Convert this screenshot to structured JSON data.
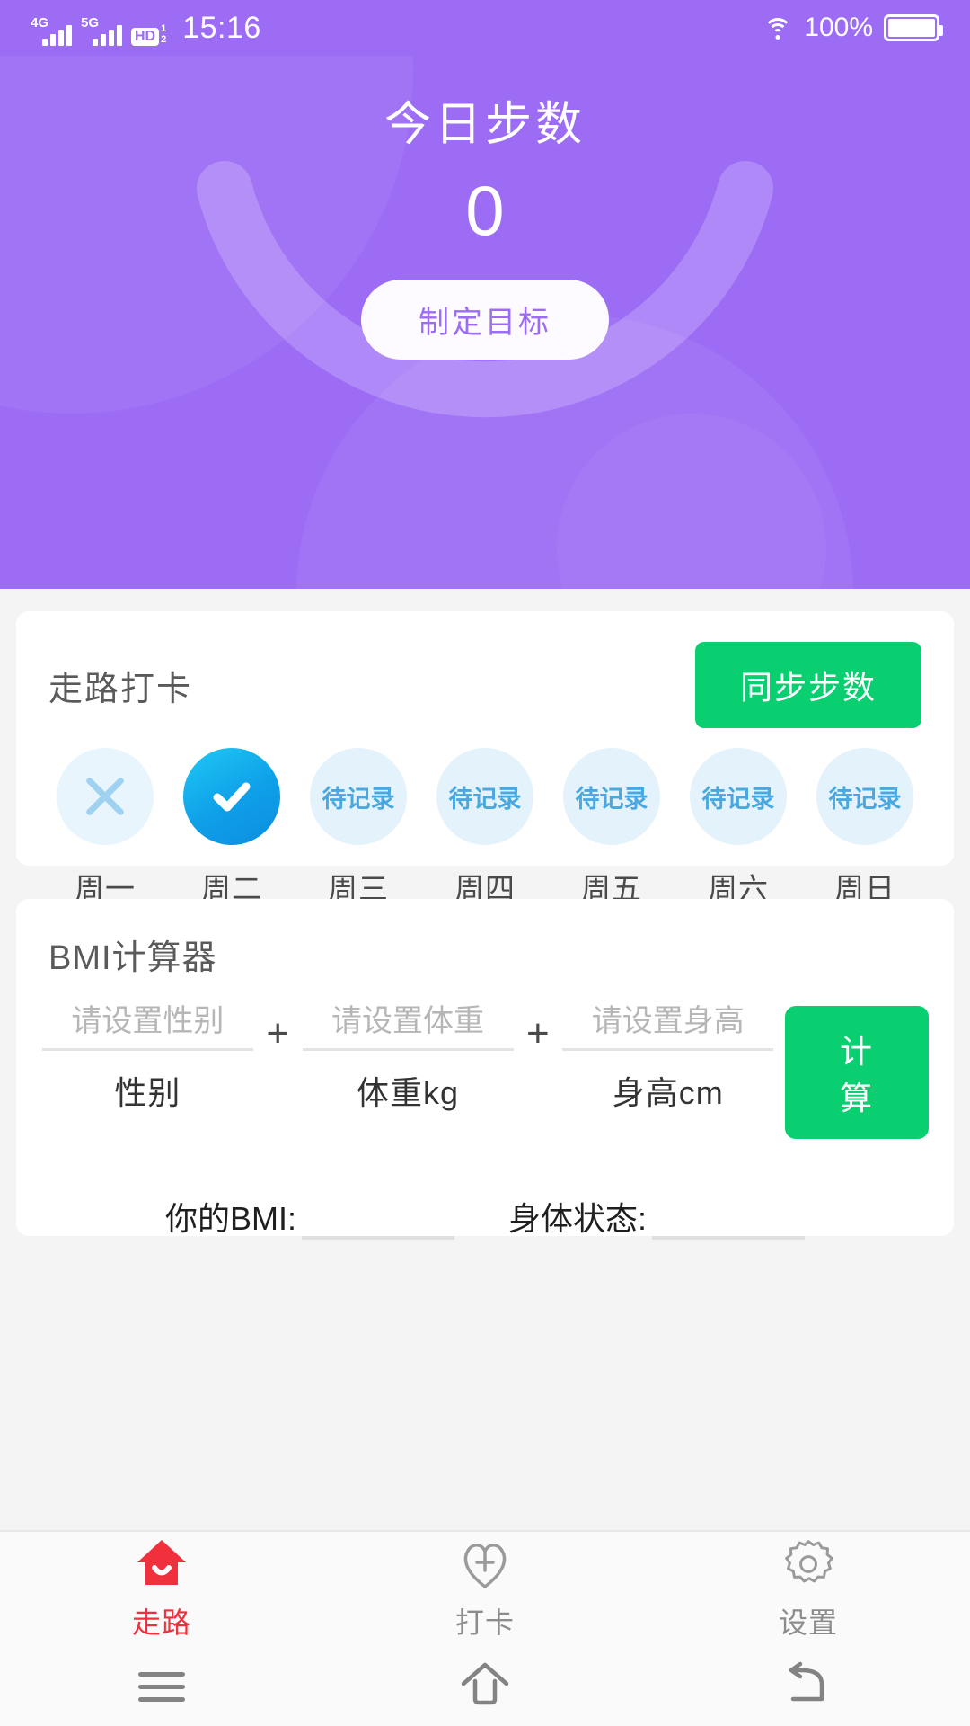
{
  "statusbar": {
    "net1": "4G",
    "net2": "5G",
    "hd_label": "HD",
    "hd_sup": "1",
    "hd_sub": "2",
    "time": "15:16",
    "battery_percent": "100%",
    "wifi_icon": "wifi-icon",
    "battery_icon": "battery-icon"
  },
  "header": {
    "title": "今日步数",
    "steps": "0",
    "goal_button": "制定目标"
  },
  "walk_card": {
    "title": "走路打卡",
    "sync_button": "同步步数",
    "days": [
      {
        "label": "周一",
        "state": "missed",
        "text": ""
      },
      {
        "label": "周二",
        "state": "done",
        "text": ""
      },
      {
        "label": "周三",
        "state": "pending",
        "text": "待记录"
      },
      {
        "label": "周四",
        "state": "pending",
        "text": "待记录"
      },
      {
        "label": "周五",
        "state": "pending",
        "text": "待记录"
      },
      {
        "label": "周六",
        "state": "pending",
        "text": "待记录"
      },
      {
        "label": "周日",
        "state": "pending",
        "text": "待记录"
      }
    ]
  },
  "bmi_card": {
    "title": "BMI计算器",
    "gender": {
      "placeholder": "请设置性别",
      "value": "",
      "unit": "性别"
    },
    "weight": {
      "placeholder": "请设置体重",
      "value": "",
      "unit": "体重kg"
    },
    "height": {
      "placeholder": "请设置身高",
      "value": "",
      "unit": "身高cm"
    },
    "plus1": "+",
    "plus2": "+",
    "calc_button": "计算",
    "result_bmi_label": "你的BMI:",
    "result_bmi_value": "",
    "result_state_label": "身体状态:",
    "result_state_value": ""
  },
  "tabbar": {
    "tabs": [
      {
        "label": "走路",
        "icon": "home-icon",
        "active": true
      },
      {
        "label": "打卡",
        "icon": "heart-plus-icon",
        "active": false
      },
      {
        "label": "设置",
        "icon": "gear-icon",
        "active": false
      }
    ]
  },
  "android_nav": {
    "menu_icon": "menu-icon",
    "home_icon": "home-outline-icon",
    "back_icon": "back-arrow-icon"
  },
  "colors": {
    "header_purple": "#9c6cf5",
    "accent_green": "#0acf71",
    "check_blue": "#0f9fe8",
    "pending_blue": "#4aa8e0",
    "active_red": "#f0303c",
    "page_bg": "#f4f4f4"
  }
}
